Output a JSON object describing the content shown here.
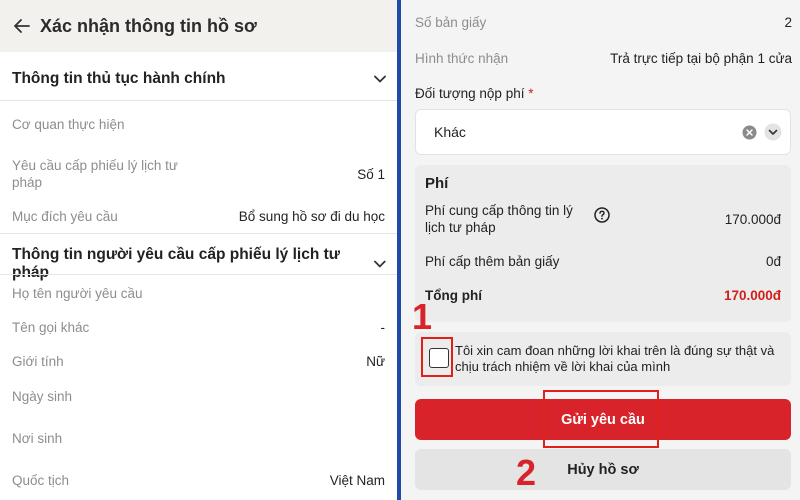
{
  "left": {
    "header_title": "Xác nhận thông tin hồ sơ",
    "section1": {
      "title": "Thông tin thủ tục hành chính",
      "rows": [
        {
          "label": "Cơ quan thực hiện",
          "value": ""
        },
        {
          "label": "Yêu cầu cấp phiếu lý lịch tư pháp",
          "value": "Số 1"
        },
        {
          "label": "Mục đích yêu cầu",
          "value": "Bổ sung hồ sơ đi du học"
        }
      ]
    },
    "section2": {
      "title": "Thông tin người yêu cầu cấp phiếu lý lịch tư pháp",
      "rows": [
        {
          "label": "Họ tên người yêu cầu",
          "value": ""
        },
        {
          "label": "Tên gọi khác",
          "value": "-"
        },
        {
          "label": "Giới tính",
          "value": "Nữ"
        },
        {
          "label": "Ngày sinh",
          "value": ""
        },
        {
          "label": "Nơi sinh",
          "value": ""
        },
        {
          "label": "Quốc tịch",
          "value": "Việt Nam"
        }
      ]
    }
  },
  "right": {
    "top_rows": [
      {
        "label": "Số bản giấy",
        "value": "2"
      },
      {
        "label": "Hình thức nhận",
        "value": "Trả trực tiếp tại bộ phận 1 cửa"
      }
    ],
    "fee_payer": {
      "label": "Đối tượng nộp phí",
      "required_mark": "*",
      "selected": "Khác"
    },
    "fee": {
      "title": "Phí",
      "rows": [
        {
          "label": "Phí cung cấp thông tin lý lịch tư pháp",
          "value": "170.000đ"
        },
        {
          "label": "Phí cấp thêm bản giấy",
          "value": "0đ"
        }
      ],
      "total_label": "Tổng phí",
      "total_value": "170.000đ"
    },
    "commitment": {
      "text": "Tôi xin cam đoan những lời khai trên là đúng sự thật và chịu trách nhiệm về lời khai của mình",
      "checked": false
    },
    "submit_label": "Gửi yêu cầu",
    "cancel_label": "Hủy hồ sơ"
  },
  "annotations": {
    "step1": "1",
    "step2": "2"
  },
  "colors": {
    "accent_red": "#d8232a",
    "separator_blue": "#1f4aa8",
    "annotation_red": "#e0201b"
  },
  "icons": [
    "back-arrow-icon",
    "chevron-down-icon",
    "clear-icon",
    "dropdown-icon",
    "help-icon",
    "checkbox"
  ]
}
